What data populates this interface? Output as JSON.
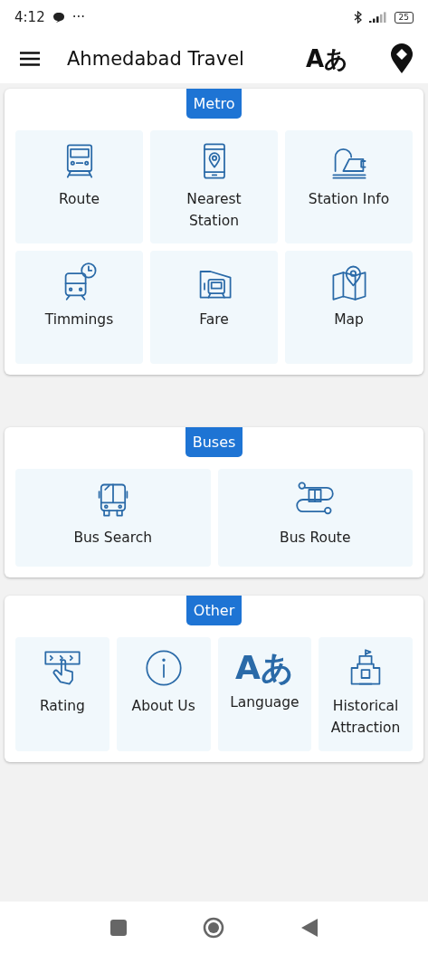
{
  "status_bar": {
    "time": "4:12",
    "dots": "···",
    "battery": "25"
  },
  "app_bar": {
    "title": "Ahmedabad Travel",
    "language_glyph": "Aあ"
  },
  "sections": [
    {
      "title": "Metro",
      "tiles": [
        {
          "kind": "icon",
          "label": "Route"
        },
        {
          "kind": "icon",
          "label": "Nearest Station"
        },
        {
          "kind": "icon",
          "label": "Station Info"
        },
        {
          "kind": "icon",
          "label": "Timmings"
        },
        {
          "kind": "icon",
          "label": "Fare"
        },
        {
          "kind": "icon",
          "label": "Map"
        }
      ]
    },
    {
      "title": "Buses",
      "tiles": [
        {
          "kind": "icon",
          "label": "Bus Search"
        },
        {
          "kind": "icon",
          "label": "Bus Route"
        }
      ]
    },
    {
      "title": "Other",
      "tiles": [
        {
          "kind": "icon",
          "label": "Rating"
        },
        {
          "kind": "icon",
          "label": "About Us"
        },
        {
          "kind": "glyph",
          "glyph": "Aあ",
          "label": "Language"
        },
        {
          "kind": "icon",
          "label": "Historical Attraction"
        }
      ]
    }
  ]
}
